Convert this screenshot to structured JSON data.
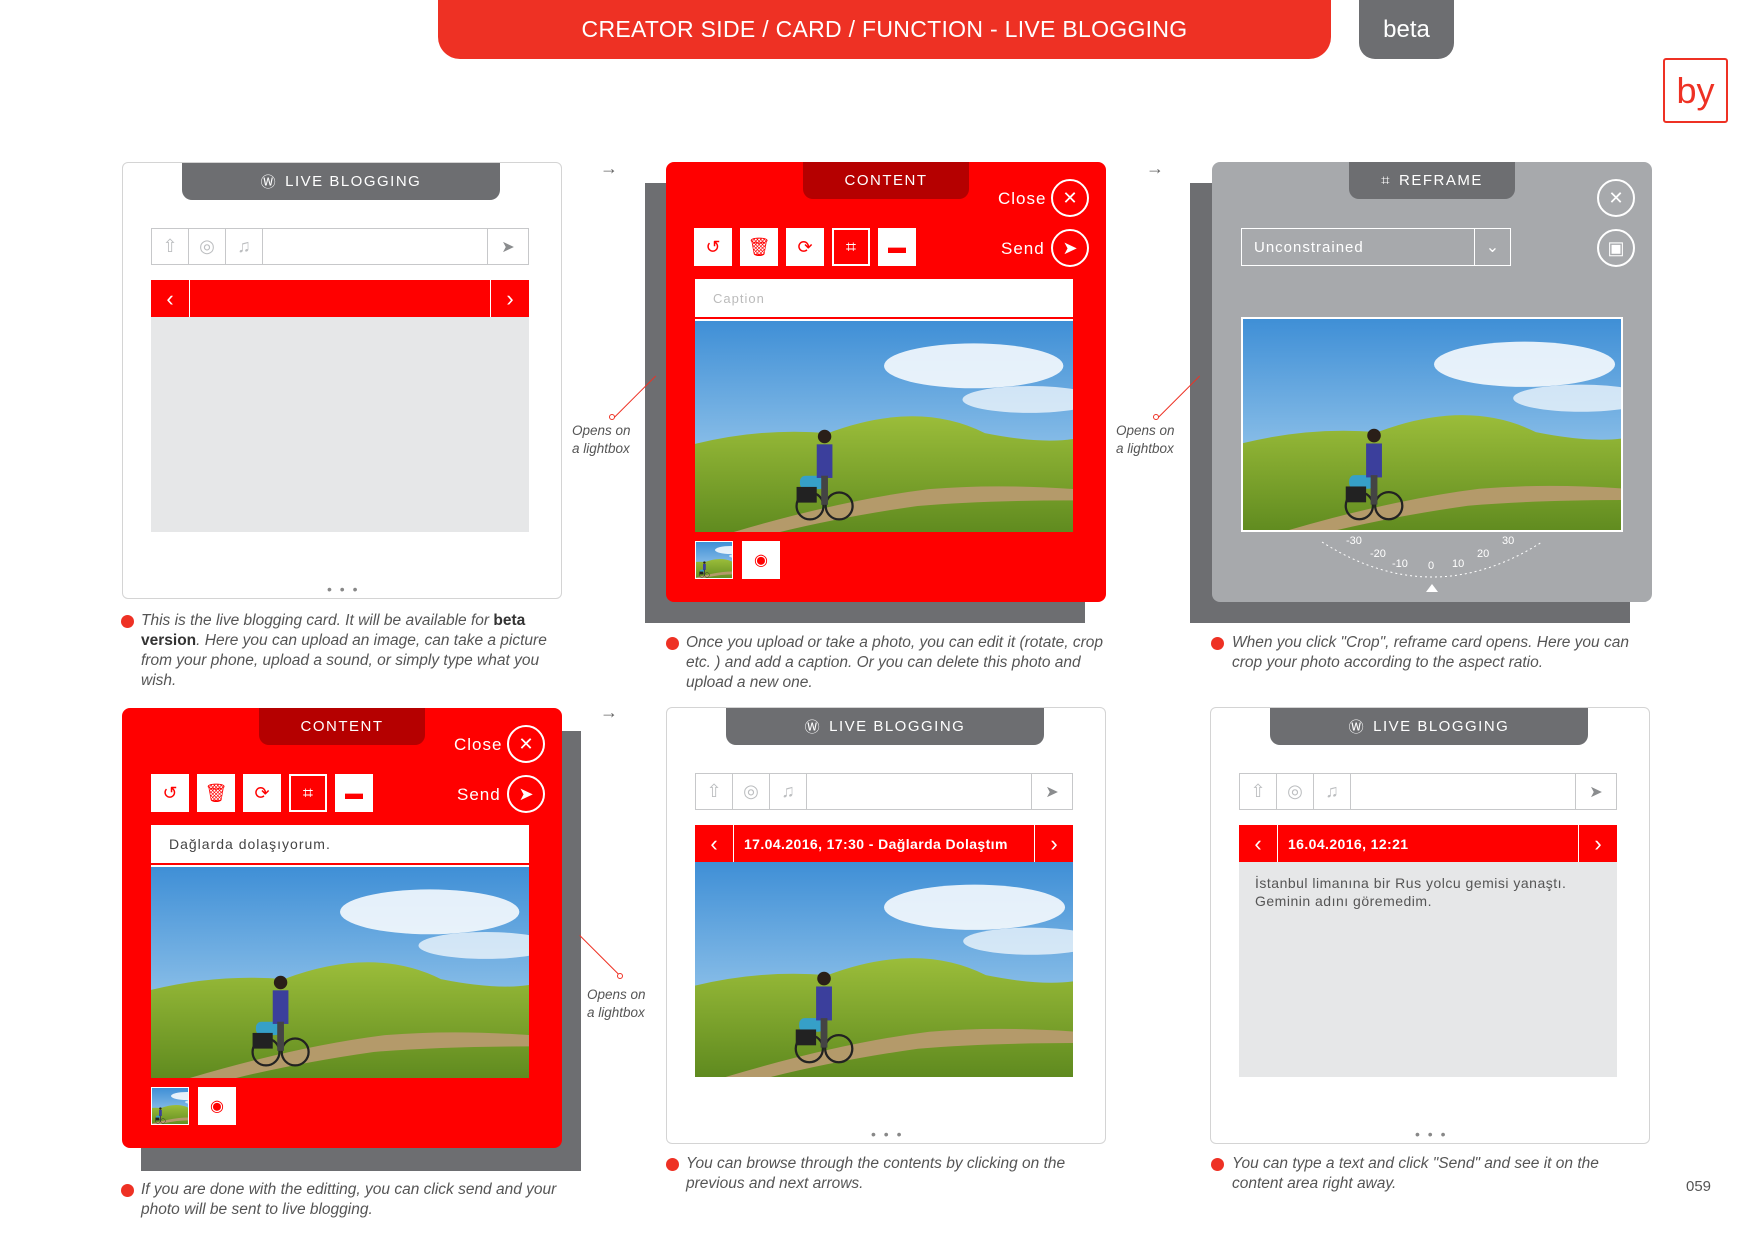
{
  "header": {
    "title": "CREATOR SIDE / CARD / FUNCTION - LIVE BLOGGING",
    "beta": "beta",
    "logo": "by",
    "page_number": "059"
  },
  "tabs": {
    "live_blogging": "LIVE BLOGGING",
    "content": "CONTENT",
    "reframe": "REFRAME"
  },
  "editor": {
    "close": "Close",
    "send": "Send",
    "caption_placeholder": "Caption",
    "caption_filled": "Dağlarda dolaşıyorum."
  },
  "reframe": {
    "ratio": "Unconstrained",
    "dial": [
      "-30",
      "-20",
      "-10",
      "0",
      "10",
      "20",
      "30"
    ]
  },
  "browse": {
    "item1": "17.04.2016, 17:30 - Dağlarda Dolaştım",
    "item2": "16.04.2016, 12:21",
    "text": "İstanbul limanına bir Rus yolcu gemisi yanaştı. Geminin adını göremedim."
  },
  "dots": "• • •",
  "opens": {
    "l1": "Opens on",
    "l2": "a lightbox"
  },
  "desc": {
    "d1a": "This is the live blogging card. It will be available for ",
    "d1b": "beta version",
    "d1c": ". Here you can upload an image, can take a picture from your phone, upload a sound, or simply type what you wish.",
    "d2": "Once you upload or take a photo, you can edit it (rotate, crop etc. ) and add a caption.  Or you can delete this photo and upload a new one.",
    "d3": "When you click \"Crop\", reframe card opens. Here you can crop your photo according to the aspect ratio.",
    "d4": "If you are done with the editting, you can click send and your photo will be sent to live blogging.",
    "d5": "You can browse through the contents by clicking on the previous and next arrows.",
    "d6": "You can type a text and click \"Send\" and see it on the content area right away."
  },
  "colors": {
    "accent": "#ee3124",
    "red": "#ff0000",
    "grey": "#6d6e71"
  }
}
